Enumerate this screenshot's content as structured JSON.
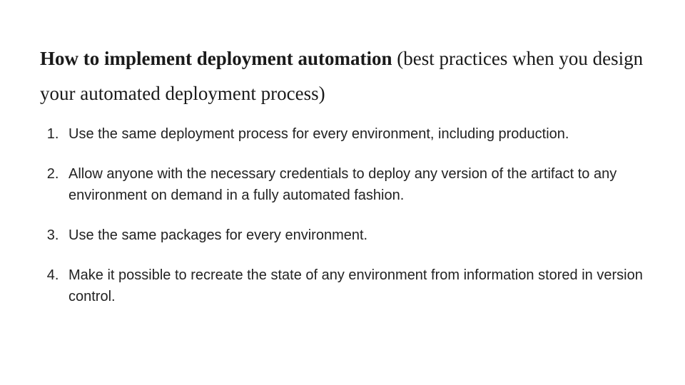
{
  "heading": {
    "bold": "How to implement deployment automation",
    "rest": " (best practices when you design your automated deployment process)"
  },
  "items": [
    "Use the same deployment process for every environment, including production.",
    "Allow anyone with the necessary credentials to deploy any version of the artifact to any environment on demand in a fully automated fashion.",
    " Use the same packages for every environment.",
    "Make it possible to recreate the state of any environment from information stored in version control."
  ]
}
